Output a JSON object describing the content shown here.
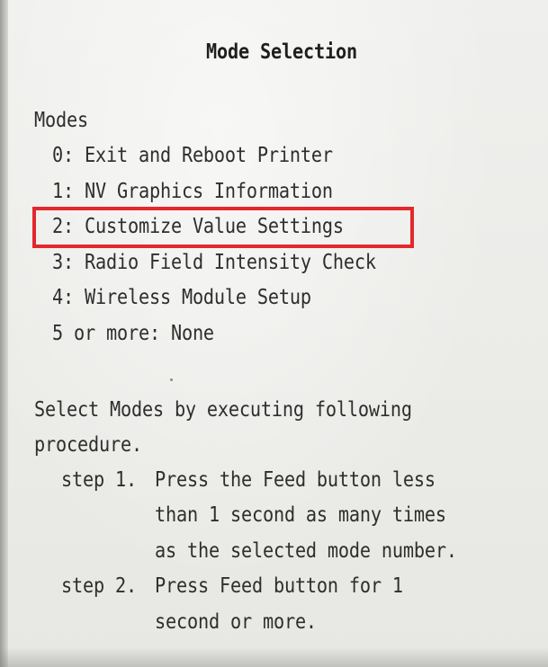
{
  "title": "Mode Selection",
  "modes_heading": "Modes",
  "modes": [
    "0: Exit and Reboot Printer",
    "1: NV Graphics Information",
    "2: Customize Value Settings",
    "3: Radio Field Intensity Check",
    "4: Wireless Module Setup",
    "5 or more: None"
  ],
  "highlighted_mode_index": 2,
  "highlight_color": "#e3282c",
  "instructions": {
    "line1": "Select Modes by executing following",
    "line2": "procedure.",
    "step1": {
      "label": "step 1.",
      "lines": [
        "Press the Feed button less",
        "than 1 second as many times",
        "as the selected mode number."
      ]
    },
    "step2": {
      "label": "step 2.",
      "lines": [
        "Press Feed button for 1",
        "second or more."
      ]
    }
  }
}
